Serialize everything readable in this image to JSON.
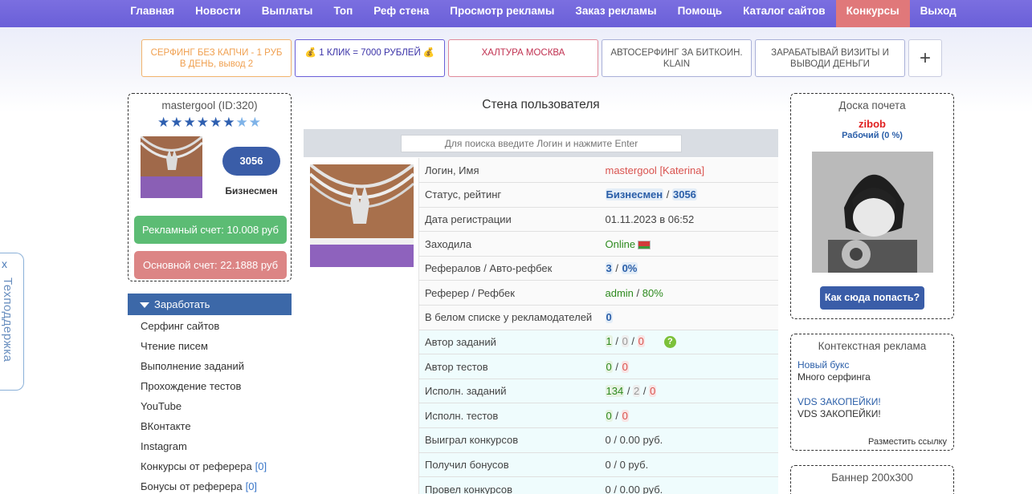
{
  "nav": {
    "items": [
      "Главная",
      "Новости",
      "Выплаты",
      "Топ",
      "Реф стена",
      "Просмотр рекламы",
      "Заказ рекламы",
      "Помощь",
      "Каталог сайтов",
      "Конкурсы",
      "Выход"
    ],
    "active": "Конкурсы"
  },
  "ads": [
    "СЕРФИНГ БЕЗ КАПЧИ - 1 РУБ В ДЕНЬ, вывод 2",
    "💰 1 КЛИК = 7000 РУБЛЕЙ 💰",
    "ХАЛТУРА МОСКВА",
    "АВТОСЕРФИНГ ЗА БИТКОИН. KLAIN",
    "ЗАРАБАТЫВАЙ ВИЗИТЫ И ВЫВОДИ ДЕНЬГИ"
  ],
  "ads_plus": "+",
  "user": {
    "title": "mastergool (ID:320)",
    "stars_filled": 6,
    "stars_total": 8,
    "rating": "3056",
    "rank": "Бизнесмен",
    "ad_account": "Рекламный счет: 10.008 руб",
    "main_account": "Основной счет: 22.1888 руб"
  },
  "earn": {
    "header": "Заработать",
    "items": [
      {
        "label": "Серфинг сайтов",
        "count": ""
      },
      {
        "label": "Чтение писем",
        "count": ""
      },
      {
        "label": "Выполнение заданий",
        "count": ""
      },
      {
        "label": "Прохождение тестов",
        "count": ""
      },
      {
        "label": "YouTube",
        "count": ""
      },
      {
        "label": "ВКонтакте",
        "count": ""
      },
      {
        "label": "Instagram",
        "count": ""
      },
      {
        "label": "Конкурсы от реферера",
        "count": "[0]"
      },
      {
        "label": "Бонусы от реферера",
        "count": "[0]"
      }
    ]
  },
  "wall": {
    "title": "Стена пользователя",
    "search_placeholder": "Для поиска введите Логин и нажмите Enter",
    "rows": {
      "login_k": "Логин, Имя",
      "login_v": "mastergool",
      "login_name": "[Katerina]",
      "status_k": "Статус, рейтинг",
      "status_rank": "Бизнесмен",
      "status_rating": "3056",
      "reg_k": "Дата регистрации",
      "reg_v": "01.11.2023 в 06:52",
      "online_k": "Заходила",
      "online_v": "Online",
      "refs_k": "Рефералов / Авто-рефбек",
      "refs_a": "3",
      "refs_b": "0%",
      "referer_k": "Реферер / Рефбек",
      "referer_a": "admin",
      "referer_b": "80%",
      "white_k": "В белом списке у рекламодателей",
      "white_v": "0",
      "authtask_k": "Автор заданий",
      "authtask_a": "1",
      "authtask_b": "0",
      "authtask_c": "0",
      "authtest_k": "Автор тестов",
      "authtest_a": "0",
      "authtest_b": "0",
      "exectask_k": "Исполн. заданий",
      "exectask_a": "134",
      "exectask_b": "2",
      "exectask_c": "0",
      "exectest_k": "Исполн. тестов",
      "exectest_a": "0",
      "exectest_b": "0",
      "won_k": "Выиграл конкурсов",
      "won_v": "0 / 0.00 руб.",
      "bonus_k": "Получил бонусов",
      "bonus_v": "0 / 0 руб.",
      "held_k": "Провел конкурсов",
      "held_v": "0 / 0.00 руб."
    }
  },
  "honor": {
    "title": "Доска почета",
    "name": "zibob",
    "rank": "Рабочий (0 %)",
    "button": "Как сюда попасть?"
  },
  "context": {
    "title": "Контекстная реклама",
    "ads": [
      {
        "link": "Новый букс",
        "text": "Много серфинга"
      },
      {
        "link": "VDS ЗАКОПЕЙКИ!",
        "text": "VDS ЗАКОПЕЙКИ!"
      }
    ],
    "place_link": "Разместить ссылку"
  },
  "banner": {
    "title": "Баннер 200x300"
  },
  "support": {
    "label": "Техподдержка",
    "close": "x"
  }
}
